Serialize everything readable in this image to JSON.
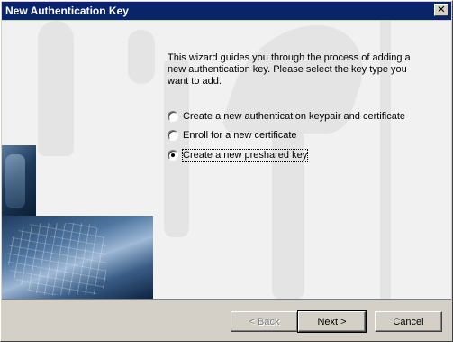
{
  "window": {
    "title": "New Authentication Key",
    "close_glyph": "✕"
  },
  "wizard": {
    "description": "This wizard guides you through the process of adding a new authentication key. Please select the key type you want to add.",
    "options": [
      {
        "label": "Create a new authentication keypair and certificate",
        "selected": false
      },
      {
        "label": "Enroll for a new certificate",
        "selected": false
      },
      {
        "label": "Create a new preshared key",
        "selected": true
      }
    ]
  },
  "buttons": {
    "back_label": "< Back",
    "next_label": "Next >",
    "cancel_label": "Cancel",
    "back_enabled": false
  },
  "colors": {
    "titlebar": "#0a246a",
    "dialog_face": "#d4d0c8",
    "content_bg": "#f1f1f1"
  },
  "icons": [
    "close-icon",
    "radio-button"
  ]
}
